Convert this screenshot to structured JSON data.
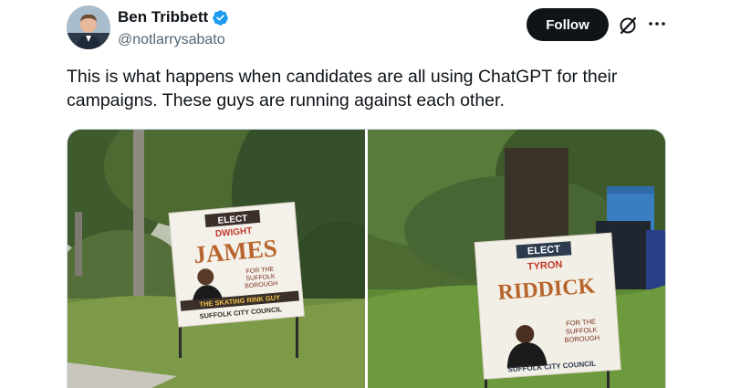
{
  "author": {
    "display_name": "Ben Tribbett",
    "handle": "@notlarrysabato",
    "avatar_icon": "avatar-portrait",
    "verified_icon": "verified-badge-icon",
    "verified_color": "#1d9bf0"
  },
  "header": {
    "follow_label": "Follow",
    "grok_icon": "grok-icon",
    "more_icon": "more-icon"
  },
  "tweet": {
    "text": "This is what happens when candidates are all using ChatGPT for their campaigns.  These guys are running against each other."
  },
  "media": {
    "left_sign": {
      "elect": "ELECT",
      "first_name": "DWIGHT",
      "last_name": "JAMES",
      "for_line1": "FOR THE",
      "for_line2": "SUFFOLK",
      "for_line3": "BOROUGH",
      "tagline": "THE SKATING RINK GUY",
      "council": "SUFFOLK CITY COUNCIL"
    },
    "right_sign": {
      "elect": "ELECT",
      "first_name": "TYRON",
      "last_name": "RIDDICK",
      "for_line1": "FOR THE",
      "for_line2": "SUFFOLK",
      "for_line3": "BOROUGH",
      "council": "SUFFOLK CITY COUNCIL"
    }
  }
}
